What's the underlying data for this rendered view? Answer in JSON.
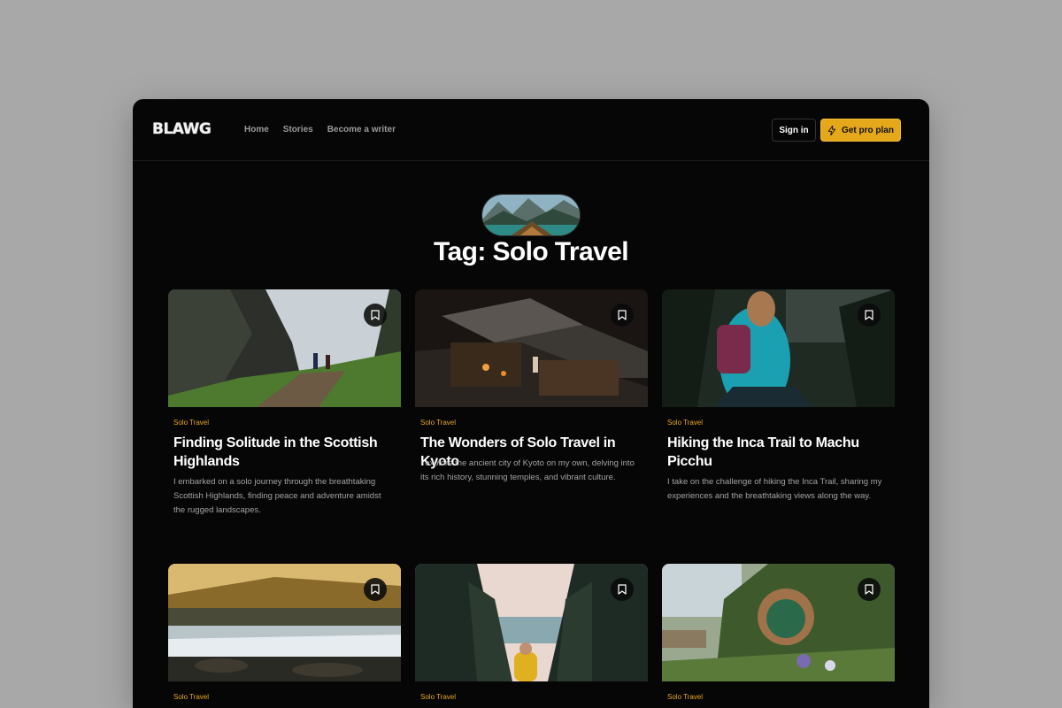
{
  "app": {
    "logo": "BLAWG",
    "nav": [
      "Home",
      "Stories",
      "Become a writer"
    ],
    "signin_label": "Sign in",
    "pro_label": "Get pro plan",
    "accent_color": "#e4a81a"
  },
  "hero": {
    "title": "Tag: Solo Travel"
  },
  "icons": {
    "bookmark": "bookmark-icon",
    "bolt": "lightning-icon"
  },
  "posts": [
    {
      "category": "Solo Travel",
      "title": "Finding Solitude in the Scottish Highlands",
      "excerpt": "I embarked on a solo journey through the breathtaking Scottish Highlands, finding peace and adventure amidst the rugged landscapes."
    },
    {
      "category": "Solo Travel",
      "title": "The Wonders of Solo Travel in Kyoto",
      "excerpt": "I explore the ancient city of Kyoto on my own, delving into its rich history, stunning temples, and vibrant culture."
    },
    {
      "category": "Solo Travel",
      "title": "Hiking the Inca Trail to Machu Picchu",
      "excerpt": "I take on the challenge of hiking the Inca Trail, sharing my experiences and the breathtaking views along the way."
    },
    {
      "category": "Solo Travel",
      "title": "",
      "excerpt": ""
    },
    {
      "category": "Solo Travel",
      "title": "",
      "excerpt": ""
    },
    {
      "category": "Solo Travel",
      "title": "",
      "excerpt": ""
    }
  ]
}
